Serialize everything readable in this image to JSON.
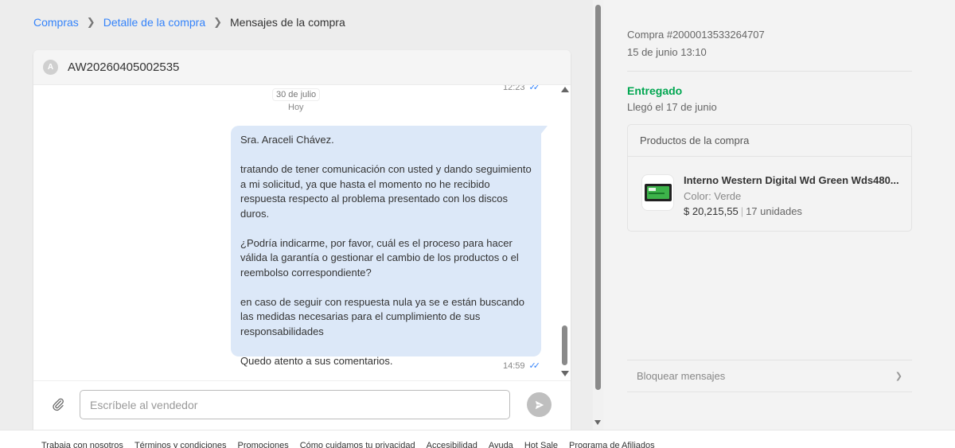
{
  "breadcrumb": {
    "items": [
      "Compras",
      "Detalle de la compra"
    ],
    "current": "Mensajes de la compra"
  },
  "chat": {
    "avatar_letter": "A",
    "order_code": "AW20260405002535",
    "prev_time": "12:23",
    "date_label": "30 de julio",
    "date_sub": "Hoy",
    "message": {
      "paragraphs": [
        "Sra. Araceli Chávez.",
        "tratando de tener comunicación con usted y dando seguimiento a mi solicitud, ya que hasta el momento no he recibido respuesta respecto al problema presentado con los discos duros.",
        "¿Podría indicarme, por favor, cuál es el proceso para hacer válida la garantía o gestionar el cambio de los productos o el reembolso correspondiente?",
        "en caso de seguir con respuesta nula ya se e están buscando las medidas necesarias para el cumplimiento de sus responsabilidades",
        "Quedo atento a sus comentarios."
      ],
      "time": "14:59"
    },
    "input": {
      "placeholder": "Escríbele al vendedor",
      "value": ""
    }
  },
  "sidebar": {
    "purchase_id": "Compra #2000013533264707",
    "purchase_date": "15 de junio 13:10",
    "status": "Entregado",
    "arrival": "Llegó el 17 de junio",
    "products_title": "Productos de la compra",
    "product": {
      "name": "Interno Western Digital Wd Green Wds480...",
      "color": "Color: Verde",
      "price": "$ 20,215,55",
      "units": "17 unidades"
    },
    "block_label": "Bloquear mensajes"
  },
  "footer": {
    "links": [
      "Trabaja con nosotros",
      "Términos y condiciones",
      "Promociones",
      "Cómo cuidamos tu privacidad",
      "Accesibilidad",
      "Ayuda",
      "Hot Sale",
      "Programa de Afiliados"
    ]
  },
  "colors": {
    "link": "#3483fa",
    "bubble": "#dce8f8",
    "status_green": "#00a650"
  },
  "icons": [
    "chevron-right-icon",
    "double-check-icon",
    "paperclip-icon",
    "send-icon",
    "ssd-product-icon",
    "scroll-up-icon",
    "scroll-down-icon"
  ]
}
